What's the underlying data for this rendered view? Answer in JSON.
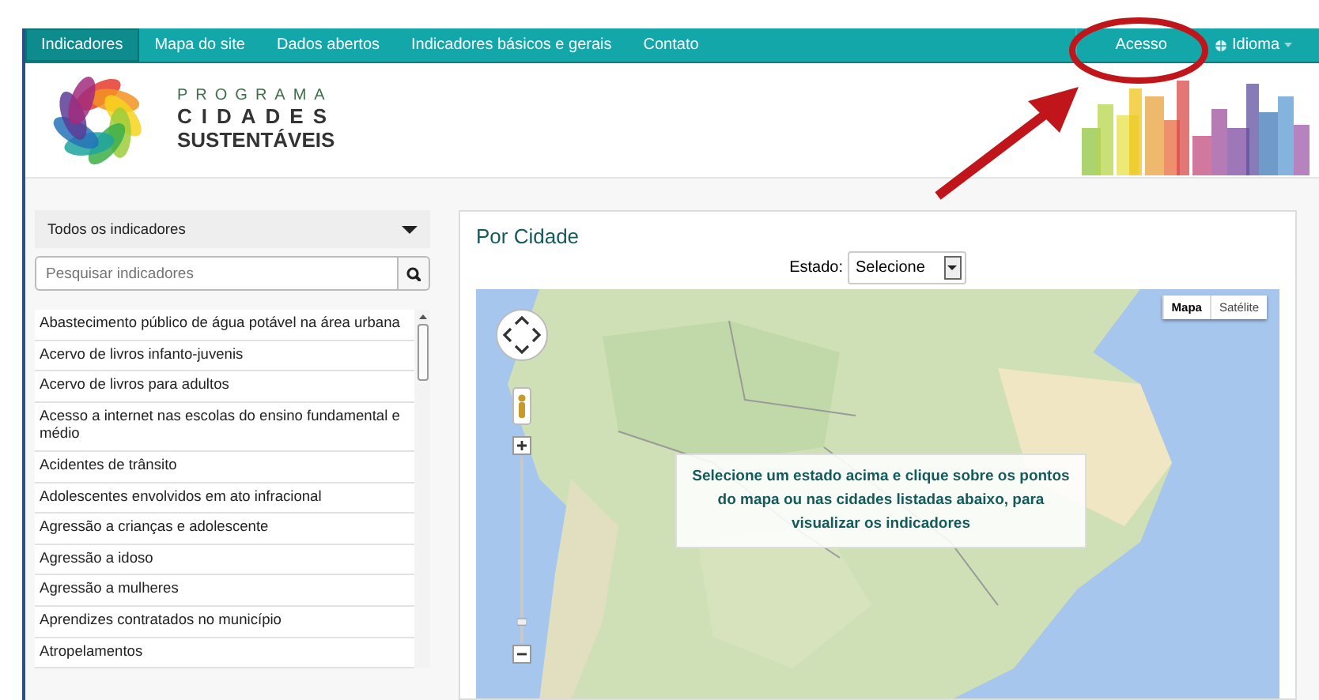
{
  "nav": {
    "items": [
      {
        "label": "Indicadores",
        "selected": true
      },
      {
        "label": "Mapa do site",
        "selected": false
      },
      {
        "label": "Dados abertos",
        "selected": false
      },
      {
        "label": "Indicadores básicos e gerais",
        "selected": false
      },
      {
        "label": "Contato",
        "selected": false
      }
    ],
    "access": "Acesso",
    "language": "Idioma"
  },
  "logo": {
    "line1": "PROGRAMA",
    "line2": "CIDADES",
    "line3": "SUSTENTÁVEIS"
  },
  "sidebar": {
    "filter": "Todos os indicadores",
    "search": {
      "placeholder": "Pesquisar indicadores"
    },
    "items": [
      "Abastecimento público de água potável na área urbana",
      "Acervo de livros infanto-juvenis",
      "Acervo de livros para adultos",
      "Acesso a internet nas escolas do ensino fundamental e médio",
      "Acidentes de trânsito",
      "Adolescentes envolvidos em ato infracional",
      "Agressão a crianças e adolescente",
      "Agressão a idoso",
      "Agressão a mulheres",
      "Aprendizes contratados no município",
      "Atropelamentos"
    ]
  },
  "map_panel": {
    "title": "Por Cidade",
    "state_label": "Estado:",
    "state_select": "Selecione",
    "zoom": {
      "level": 0.1
    },
    "map_types": [
      {
        "label": "Mapa",
        "selected": true
      },
      {
        "label": "Satélite",
        "selected": false
      }
    ],
    "message": "Selecione um estado acima e clique sobre os pontos do mapa ou nas cidades listadas abaixo, para visualizar os indicadores"
  }
}
